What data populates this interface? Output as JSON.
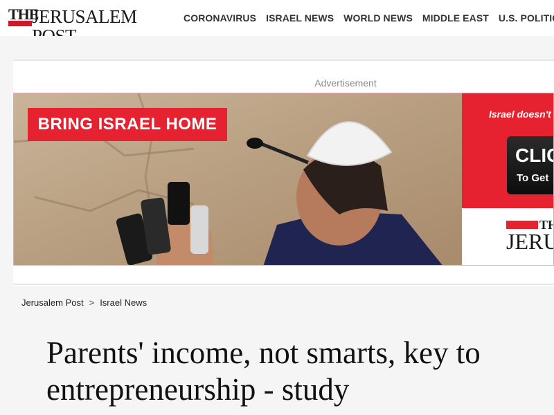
{
  "header": {
    "logo": {
      "the": "THE",
      "name": "JERUSALEM POST"
    },
    "nav": [
      "CORONAVIRUS",
      "ISRAEL NEWS",
      "WORLD NEWS",
      "MIDDLE EAST",
      "U.S. POLITICS"
    ]
  },
  "ad": {
    "label": "Advertisement",
    "headline": "BRING ISRAEL HOME",
    "tagline": "Israel doesn't f",
    "click_label": "CLIC",
    "click_sub": "To Get",
    "logo_the": "THE",
    "logo_name": "JERUSALE",
    "colors": {
      "brand_red": "#e62230"
    }
  },
  "breadcrumb": {
    "home": "Jerusalem Post",
    "separator": ">",
    "section": "Israel News"
  },
  "article": {
    "title": "Parents' income, not smarts, key to entrepreneurship - study"
  }
}
